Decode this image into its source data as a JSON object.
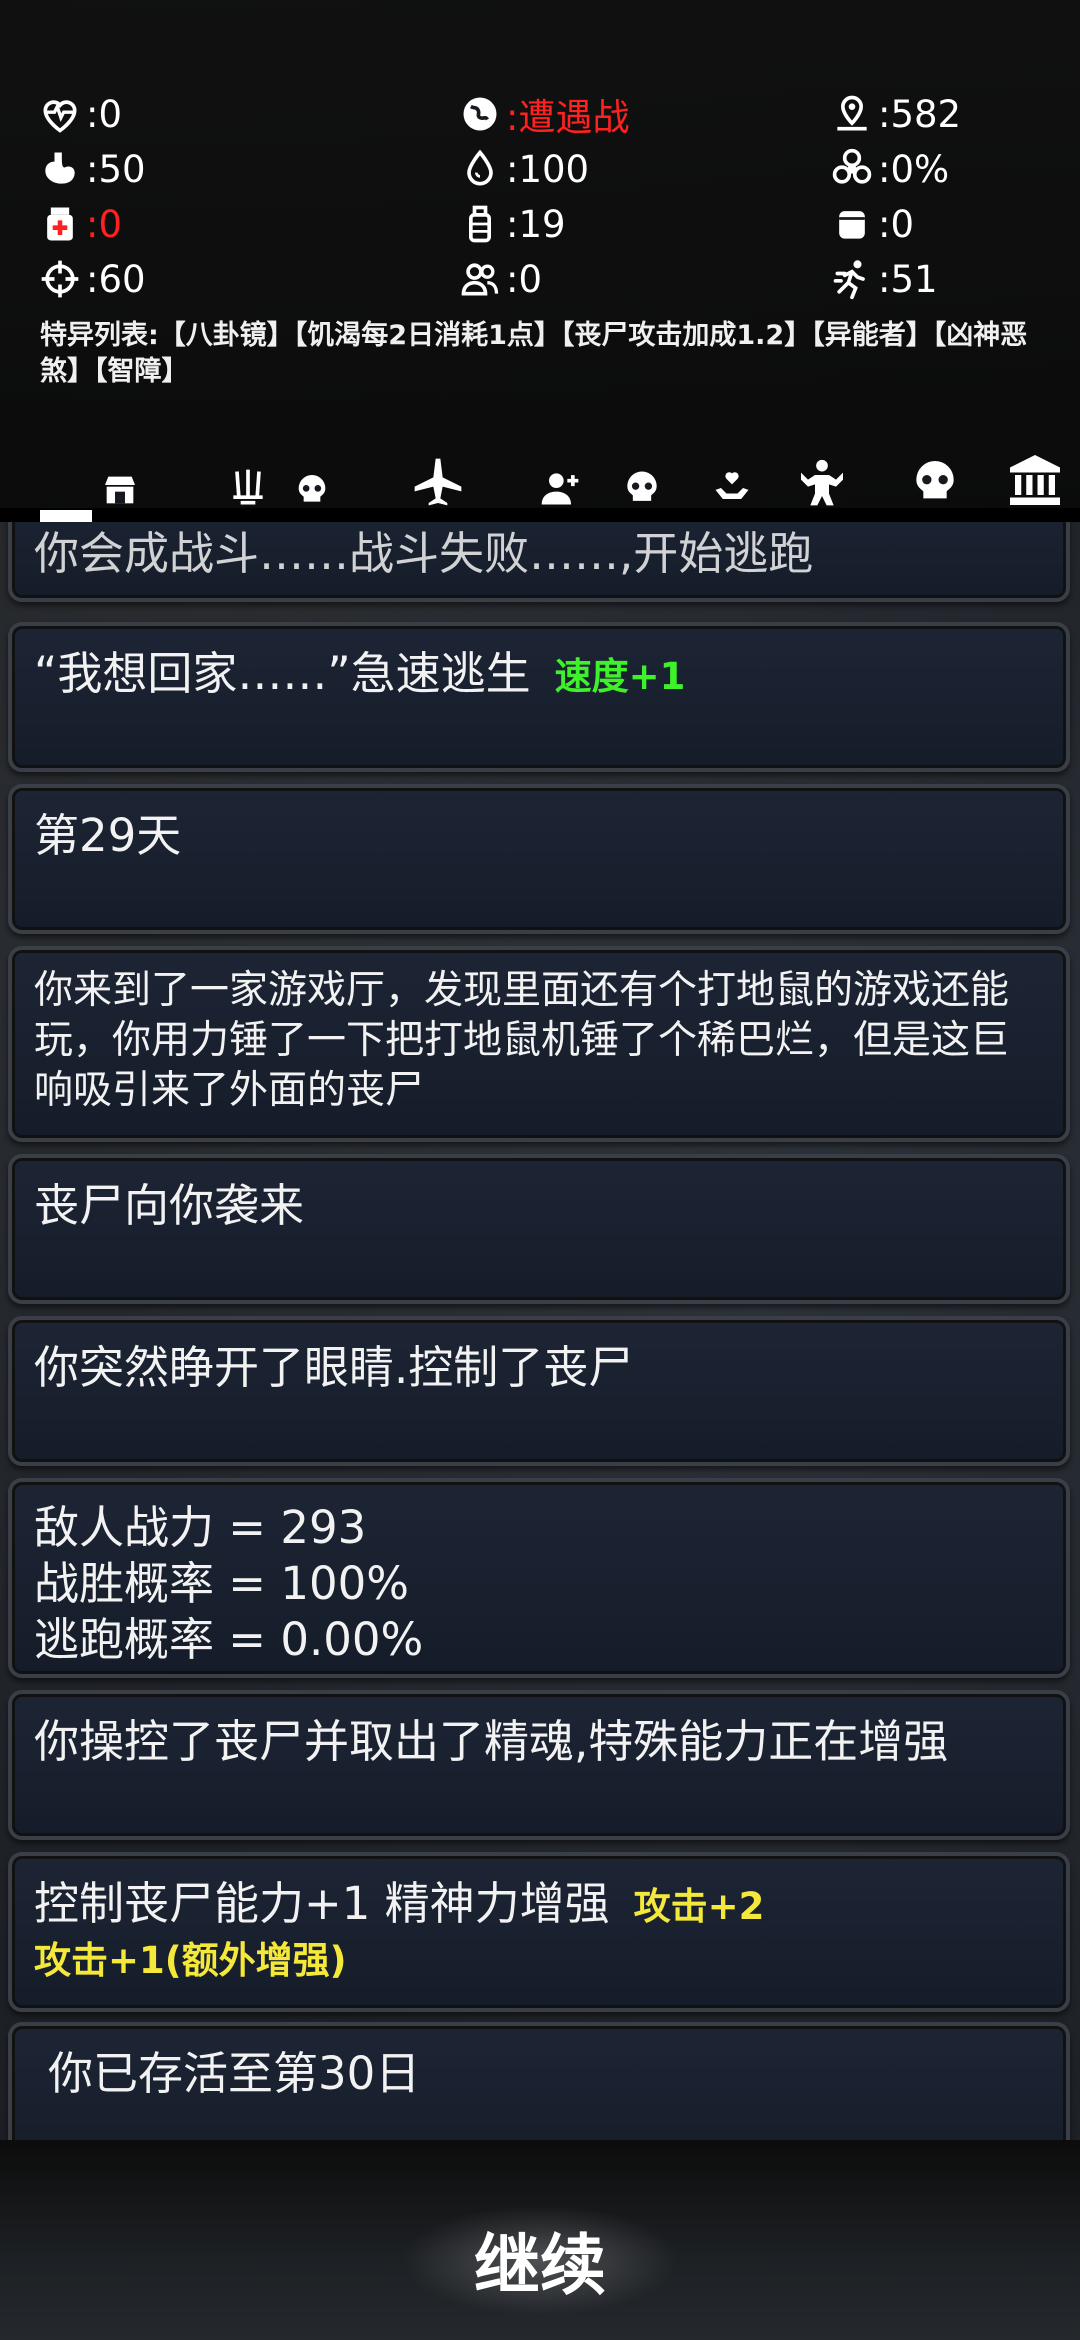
{
  "stats": {
    "health": ":0",
    "encounter": ":遭遇战",
    "distance": ":582",
    "hunger": ":50",
    "water": ":100",
    "infection": ":0%",
    "medicine": ":0",
    "bottle": ":19",
    "food": ":0",
    "aim": ":60",
    "companions": ":0",
    "speed": ":51"
  },
  "traits": "特异列表:【八卦镜】【饥渴每2日消耗1点】【丧尸攻击加成1.2】【异能者】【凶神恶煞】【智障】",
  "log": {
    "partial": "你会成战斗……战斗失败……,开始逃跑",
    "escape_text": "“我想回家……”急速逃生",
    "escape_tag": "速度+1",
    "day": "第29天",
    "arcade": "你来到了一家游戏厅，发现里面还有个打地鼠的游戏还能玩，你用力锤了一下把打地鼠机锤了个稀巴烂，但是这巨响吸引来了外面的丧尸",
    "zombie_attack": "丧尸向你袭来",
    "eyes_open": "你突然睁开了眼睛.控制了丧尸",
    "enemy_power": "敌人战力 = 293",
    "win_rate": "战胜概率 = 100%",
    "escape_rate": "逃跑概率 = 0.00%",
    "extract": "你操控了丧尸并取出了精魂,特殊能力正在增强",
    "control_text": "控制丧尸能力+1 精神力增强",
    "control_tag": "攻击+2",
    "control_extra": "攻击+1(额外增强)",
    "survived": "你已存活至第30日"
  },
  "continue_label": "继续"
}
